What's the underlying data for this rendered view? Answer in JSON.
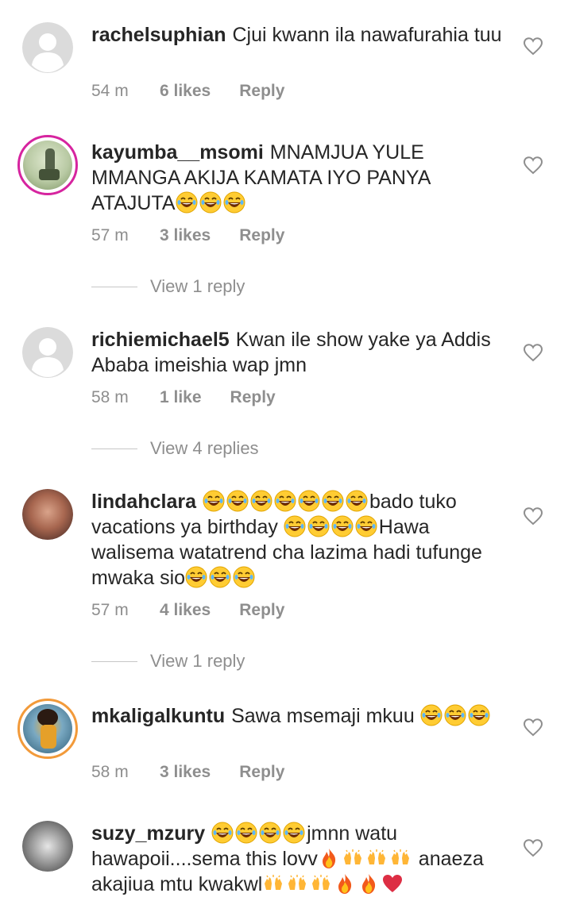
{
  "comments": [
    {
      "username": "rachelsuphian",
      "text": "Cjui kwann ila nawafurahia tuu",
      "time": "54 m",
      "likes": "6 likes",
      "reply": "Reply",
      "avatar": "default-avatar-icon"
    },
    {
      "username": "kayumba__msomi",
      "text": "MNAMJUA YULE MMANGA AKIJA KAMATA IYO PANYA ATAJUTA",
      "time": "57 m",
      "likes": "3 likes",
      "reply": "Reply",
      "view_replies": "View 1 reply",
      "avatar": "photo-avatar"
    },
    {
      "username": "richiemichael5",
      "text": "Kwan ile show yake ya Addis Ababa imeishia wap jmn",
      "time": "58 m",
      "likes": "1 like",
      "reply": "Reply",
      "view_replies": "View 4 replies",
      "avatar": "default-avatar-icon"
    },
    {
      "username": "lindahclara",
      "text_parts": [
        "bado tuko vacations ya birthday ",
        "Hawa walisema watatrend cha lazima hadi tufunge mwaka sio"
      ],
      "time": "57 m",
      "likes": "4 likes",
      "reply": "Reply",
      "view_replies": "View 1 reply",
      "avatar": "photo-avatar"
    },
    {
      "username": "mkaligalkuntu",
      "text": "Sawa msemaji mkuu ",
      "time": "58 m",
      "likes": "3 likes",
      "reply": "Reply",
      "avatar": "photo-avatar"
    },
    {
      "username": "suzy_mzury",
      "text_parts": [
        "jmnn watu hawapoii....sema this lovv",
        " anaeza akajiua mtu kwakwl"
      ],
      "avatar": "photo-avatar"
    }
  ],
  "colors": {
    "text": "#262626",
    "meta": "#8e8e8e",
    "story_ring": "#d6249f",
    "story_ring_alt": "#f29a3a"
  }
}
